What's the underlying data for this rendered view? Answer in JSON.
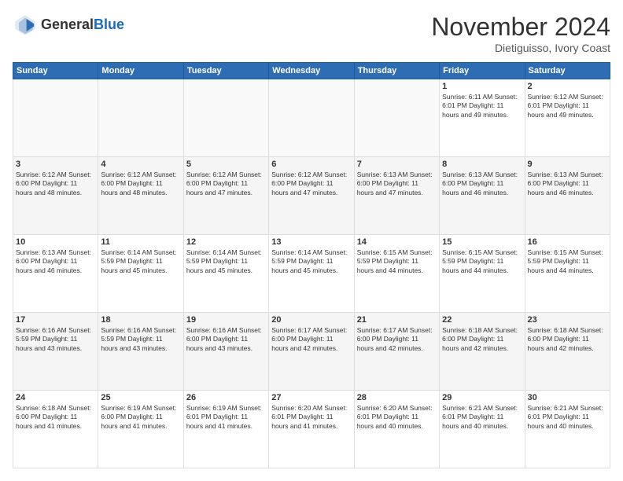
{
  "header": {
    "logo_general": "General",
    "logo_blue": "Blue",
    "month_title": "November 2024",
    "location": "Dietiguisso, Ivory Coast"
  },
  "days_of_week": [
    "Sunday",
    "Monday",
    "Tuesday",
    "Wednesday",
    "Thursday",
    "Friday",
    "Saturday"
  ],
  "weeks": [
    [
      {
        "day": "",
        "info": ""
      },
      {
        "day": "",
        "info": ""
      },
      {
        "day": "",
        "info": ""
      },
      {
        "day": "",
        "info": ""
      },
      {
        "day": "",
        "info": ""
      },
      {
        "day": "1",
        "info": "Sunrise: 6:11 AM\nSunset: 6:01 PM\nDaylight: 11 hours and 49 minutes."
      },
      {
        "day": "2",
        "info": "Sunrise: 6:12 AM\nSunset: 6:01 PM\nDaylight: 11 hours and 49 minutes."
      }
    ],
    [
      {
        "day": "3",
        "info": "Sunrise: 6:12 AM\nSunset: 6:00 PM\nDaylight: 11 hours and 48 minutes."
      },
      {
        "day": "4",
        "info": "Sunrise: 6:12 AM\nSunset: 6:00 PM\nDaylight: 11 hours and 48 minutes."
      },
      {
        "day": "5",
        "info": "Sunrise: 6:12 AM\nSunset: 6:00 PM\nDaylight: 11 hours and 47 minutes."
      },
      {
        "day": "6",
        "info": "Sunrise: 6:12 AM\nSunset: 6:00 PM\nDaylight: 11 hours and 47 minutes."
      },
      {
        "day": "7",
        "info": "Sunrise: 6:13 AM\nSunset: 6:00 PM\nDaylight: 11 hours and 47 minutes."
      },
      {
        "day": "8",
        "info": "Sunrise: 6:13 AM\nSunset: 6:00 PM\nDaylight: 11 hours and 46 minutes."
      },
      {
        "day": "9",
        "info": "Sunrise: 6:13 AM\nSunset: 6:00 PM\nDaylight: 11 hours and 46 minutes."
      }
    ],
    [
      {
        "day": "10",
        "info": "Sunrise: 6:13 AM\nSunset: 6:00 PM\nDaylight: 11 hours and 46 minutes."
      },
      {
        "day": "11",
        "info": "Sunrise: 6:14 AM\nSunset: 5:59 PM\nDaylight: 11 hours and 45 minutes."
      },
      {
        "day": "12",
        "info": "Sunrise: 6:14 AM\nSunset: 5:59 PM\nDaylight: 11 hours and 45 minutes."
      },
      {
        "day": "13",
        "info": "Sunrise: 6:14 AM\nSunset: 5:59 PM\nDaylight: 11 hours and 45 minutes."
      },
      {
        "day": "14",
        "info": "Sunrise: 6:15 AM\nSunset: 5:59 PM\nDaylight: 11 hours and 44 minutes."
      },
      {
        "day": "15",
        "info": "Sunrise: 6:15 AM\nSunset: 5:59 PM\nDaylight: 11 hours and 44 minutes."
      },
      {
        "day": "16",
        "info": "Sunrise: 6:15 AM\nSunset: 5:59 PM\nDaylight: 11 hours and 44 minutes."
      }
    ],
    [
      {
        "day": "17",
        "info": "Sunrise: 6:16 AM\nSunset: 5:59 PM\nDaylight: 11 hours and 43 minutes."
      },
      {
        "day": "18",
        "info": "Sunrise: 6:16 AM\nSunset: 5:59 PM\nDaylight: 11 hours and 43 minutes."
      },
      {
        "day": "19",
        "info": "Sunrise: 6:16 AM\nSunset: 6:00 PM\nDaylight: 11 hours and 43 minutes."
      },
      {
        "day": "20",
        "info": "Sunrise: 6:17 AM\nSunset: 6:00 PM\nDaylight: 11 hours and 42 minutes."
      },
      {
        "day": "21",
        "info": "Sunrise: 6:17 AM\nSunset: 6:00 PM\nDaylight: 11 hours and 42 minutes."
      },
      {
        "day": "22",
        "info": "Sunrise: 6:18 AM\nSunset: 6:00 PM\nDaylight: 11 hours and 42 minutes."
      },
      {
        "day": "23",
        "info": "Sunrise: 6:18 AM\nSunset: 6:00 PM\nDaylight: 11 hours and 42 minutes."
      }
    ],
    [
      {
        "day": "24",
        "info": "Sunrise: 6:18 AM\nSunset: 6:00 PM\nDaylight: 11 hours and 41 minutes."
      },
      {
        "day": "25",
        "info": "Sunrise: 6:19 AM\nSunset: 6:00 PM\nDaylight: 11 hours and 41 minutes."
      },
      {
        "day": "26",
        "info": "Sunrise: 6:19 AM\nSunset: 6:01 PM\nDaylight: 11 hours and 41 minutes."
      },
      {
        "day": "27",
        "info": "Sunrise: 6:20 AM\nSunset: 6:01 PM\nDaylight: 11 hours and 41 minutes."
      },
      {
        "day": "28",
        "info": "Sunrise: 6:20 AM\nSunset: 6:01 PM\nDaylight: 11 hours and 40 minutes."
      },
      {
        "day": "29",
        "info": "Sunrise: 6:21 AM\nSunset: 6:01 PM\nDaylight: 11 hours and 40 minutes."
      },
      {
        "day": "30",
        "info": "Sunrise: 6:21 AM\nSunset: 6:01 PM\nDaylight: 11 hours and 40 minutes."
      }
    ]
  ]
}
